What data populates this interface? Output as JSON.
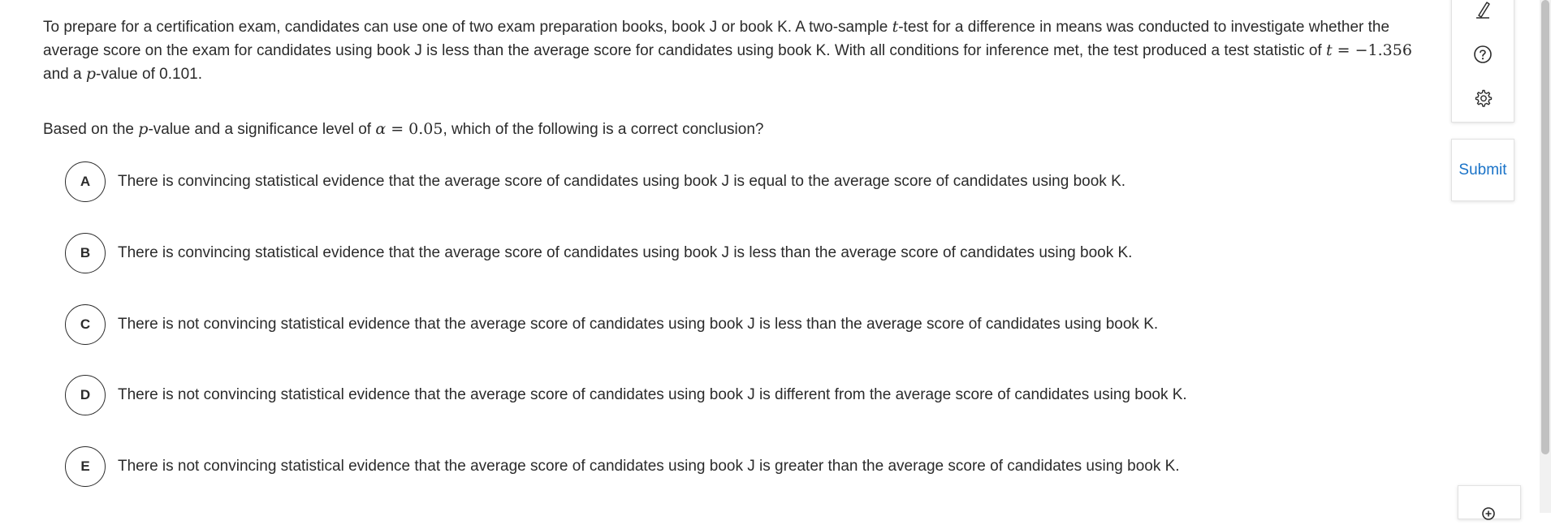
{
  "question": {
    "p1": "To prepare for a certification exam, candidates can use one of two exam preparation books, book J or book K. A two-sample ",
    "t_var": "t",
    "p2": "-test for a difference in means was conducted to investigate whether the average score on the exam for candidates using book J is less than the average score for candidates using book K. With all conditions for inference met, the test produced a test statistic of ",
    "t_eq_var": "t",
    "t_eq_rest": " = −1.356",
    "p3": " and a ",
    "p_var": "p",
    "p4": "-value of 0.101."
  },
  "prompt": {
    "p1": "Based on the ",
    "p_var": "p",
    "p2": "-value and a significance level of ",
    "alpha_var": "α",
    "alpha_rest": " = 0.05",
    "p3": ", which of the following is a correct conclusion?"
  },
  "choices": [
    {
      "letter": "A",
      "text": "There is convincing statistical evidence that the average score of candidates using book J is equal to the average score of candidates using book K."
    },
    {
      "letter": "B",
      "text": "There is convincing statistical evidence that the average score of candidates using book J is less than the average score of candidates using book K."
    },
    {
      "letter": "C",
      "text": "There is not convincing statistical evidence that the average score of candidates using book J is less than the average score of candidates using book K."
    },
    {
      "letter": "D",
      "text": "There is not convincing statistical evidence that the average score of candidates using book J is different from the average score of candidates using book K."
    },
    {
      "letter": "E",
      "text": "There is not convincing statistical evidence that the average score of candidates using book J is greater than the average score of candidates using book K."
    }
  ],
  "toolbar": {
    "icons": [
      "pencil-icon",
      "help-icon",
      "settings-icon"
    ],
    "submit_label": "Submit",
    "bottom_icon": "zoom-icon"
  },
  "colors": {
    "text": "#2b2b2b",
    "submit": "#1a73c8",
    "panel_border": "#e2e2e2"
  }
}
